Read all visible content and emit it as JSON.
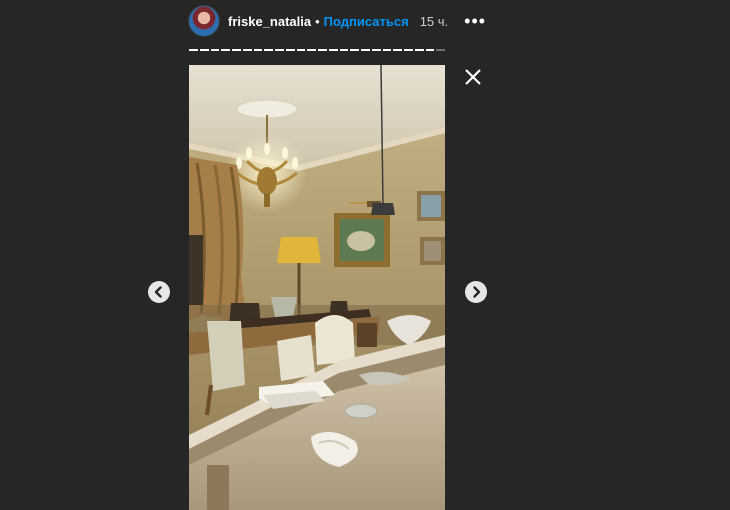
{
  "header": {
    "avatar_icon": "user-avatar",
    "username": "friske_natalia",
    "separator": "•",
    "follow_label": "Подписаться",
    "time": "15 ч.",
    "more_label": "•••"
  },
  "progress": {
    "total_segments": 24,
    "completed_segments": 23
  },
  "story": {
    "media_type": "photo",
    "scene_icon": "dining-room-photo"
  },
  "controls": {
    "close_icon": "close-icon",
    "prev_icon": "chevron-left-icon",
    "next_icon": "chevron-right-icon"
  },
  "colors": {
    "background": "#262626",
    "accent": "#0095f6",
    "text": "#ffffff"
  }
}
